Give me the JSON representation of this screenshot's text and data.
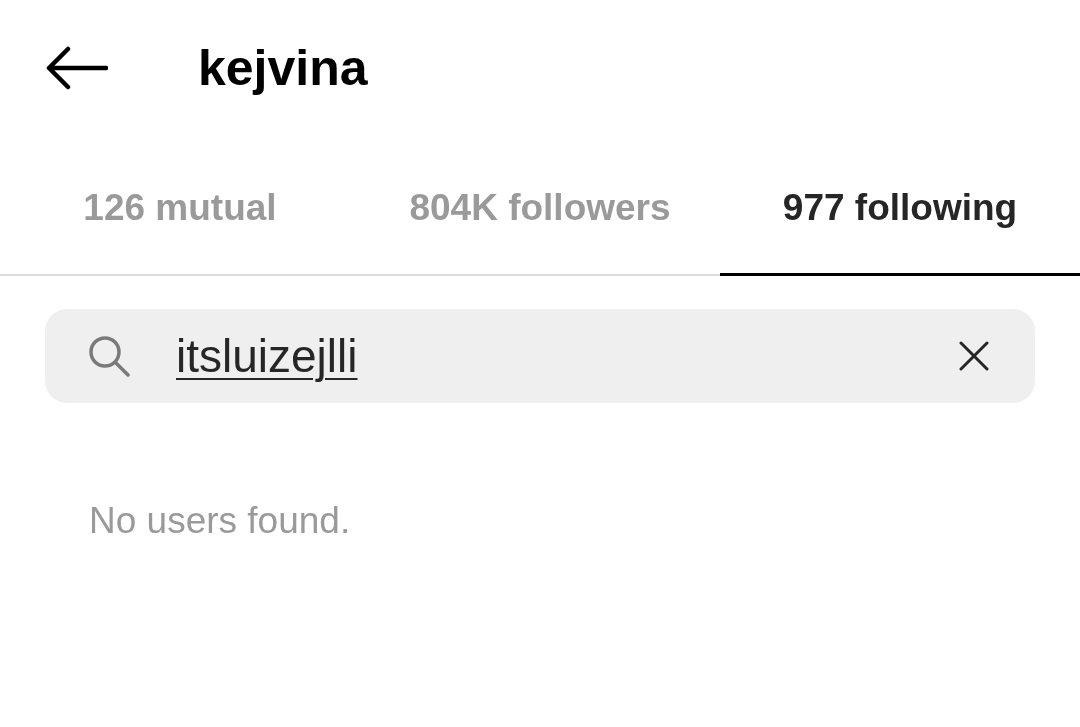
{
  "header": {
    "title": "kejvina"
  },
  "tabs": [
    {
      "label": "126 mutual",
      "selected": false
    },
    {
      "label": "804K followers",
      "selected": false
    },
    {
      "label": "977 following",
      "selected": true
    }
  ],
  "search": {
    "value": "itsluizejlli",
    "composing": true
  },
  "empty_message": "No users found."
}
